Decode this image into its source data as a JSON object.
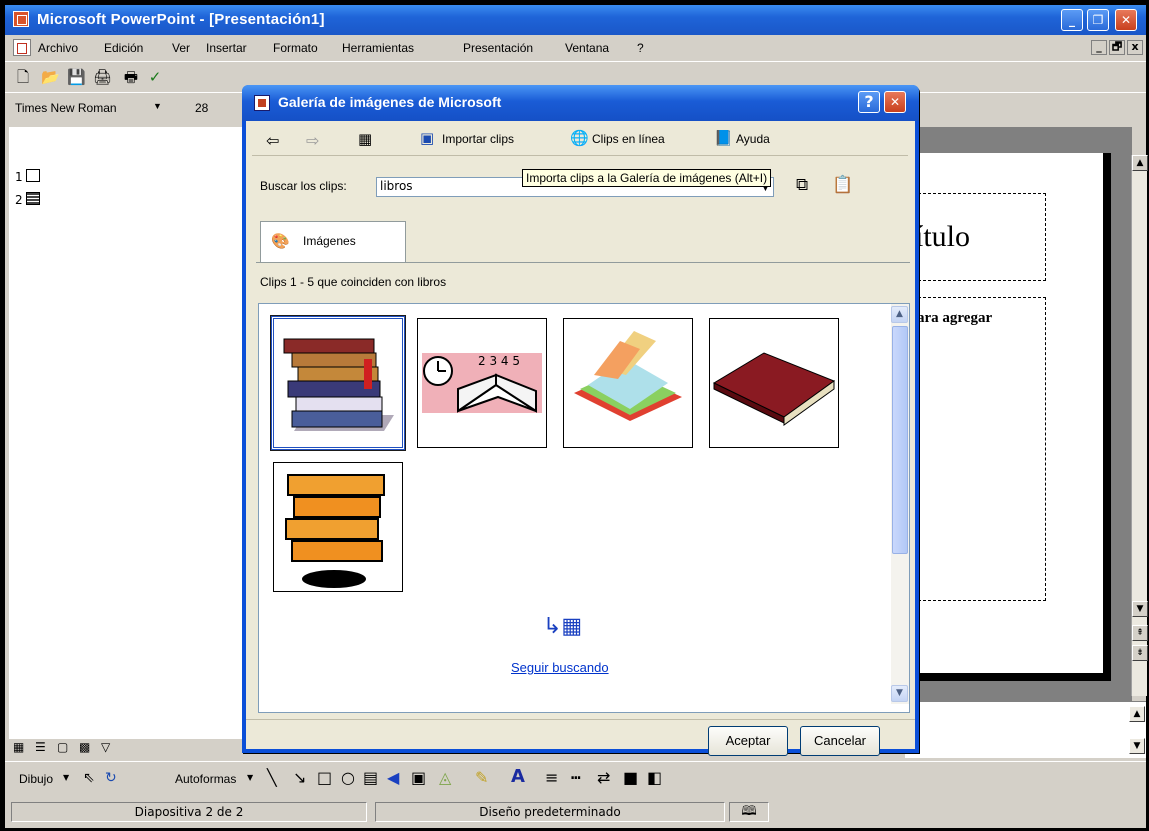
{
  "app": {
    "title": "Microsoft PowerPoint - [Presentación1]",
    "window_controls": [
      "_",
      "❐",
      "✕"
    ],
    "doc_controls": [
      "_",
      "🗗",
      "x"
    ]
  },
  "menu": [
    {
      "label": "Archivo"
    },
    {
      "label": "Edición"
    },
    {
      "label": "Ver"
    },
    {
      "label": "Insertar"
    },
    {
      "label": "Formato"
    },
    {
      "label": "Herramientas"
    },
    {
      "label": "Presentación"
    },
    {
      "label": "Ventana"
    },
    {
      "label": "?"
    }
  ],
  "formatting": {
    "font_name": "Times New Roman",
    "font_size": "28"
  },
  "outline": {
    "slide1": "1",
    "slide2": "2"
  },
  "slide": {
    "title_fragment": "ítulo",
    "body_fragment": "ara agregar"
  },
  "dialog": {
    "title": "Galería de imágenes de Microsoft",
    "help_btn": "?",
    "close_btn": "✕",
    "toolbar": {
      "import_label": "Importar clips",
      "online_label": "Clips en línea",
      "help_label": "Ayuda"
    },
    "search_label": "Buscar los clips:",
    "search_value": "libros",
    "tooltip": "Importa clips a la Galería de imágenes (Alt+I)",
    "tab_label": "Imágenes",
    "results_text": "Clips 1 - 5 que coinciden con libros",
    "continue_link": "Seguir buscando",
    "ok_button": "Aceptar",
    "cancel_button": "Cancelar"
  },
  "drawing_toolbar": {
    "draw_label": "Dibujo",
    "autoshapes_label": "Autoformas"
  },
  "status": {
    "slide": "Diapositiva 2 de 2",
    "design": "Diseño predeterminado"
  },
  "colors": {
    "xp_title": "#1a57c8",
    "dialog_bg": "#ece9d8",
    "tooltip_bg": "#ffffe1",
    "link": "#0033cc"
  }
}
